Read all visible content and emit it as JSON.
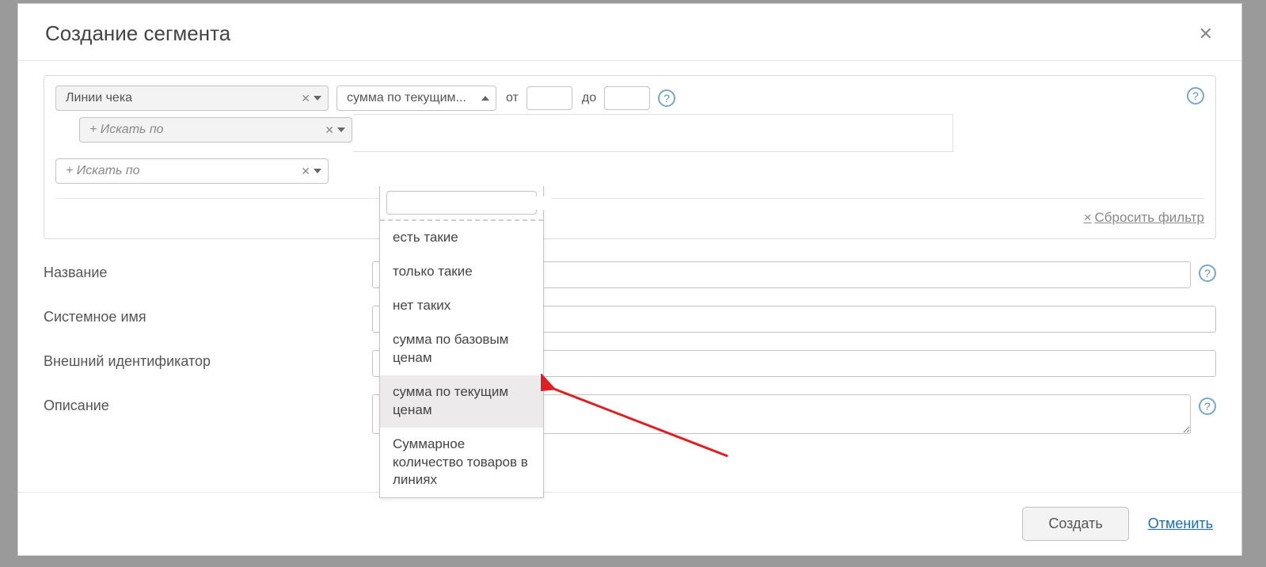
{
  "modal": {
    "title": "Создание сегмента"
  },
  "filter": {
    "primary_value": "Линии чека",
    "search_placeholder": "+ Искать по",
    "sum_selected": "сумма по текущим...",
    "range_from_label": "от",
    "range_to_label": "до",
    "reset_label": "Сбросить фильтр"
  },
  "dropdown": {
    "options": {
      "0": "есть такие",
      "1": "только такие",
      "2": "нет таких",
      "3": "сумма по базовым ценам",
      "4": "сумма по текущим ценам",
      "5": "Суммарное количество товаров в линиях"
    }
  },
  "form": {
    "name_label": "Название",
    "system_name_label": "Системное имя",
    "external_id_label": "Внешний идентификатор",
    "description_label": "Описание"
  },
  "footer": {
    "create_label": "Создать",
    "cancel_label": "Отменить"
  }
}
